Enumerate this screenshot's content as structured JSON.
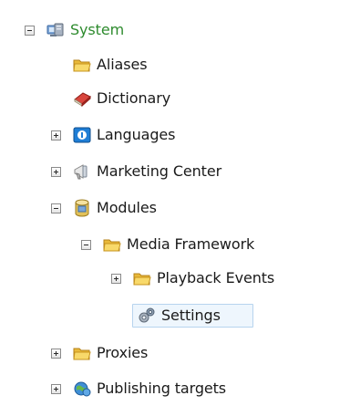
{
  "tree": {
    "system": {
      "label": "System",
      "icon": "system-icon",
      "state": "expanded"
    },
    "aliases": {
      "label": "Aliases",
      "icon": "folder-icon"
    },
    "dictionary": {
      "label": "Dictionary",
      "icon": "book-icon"
    },
    "languages": {
      "label": "Languages",
      "icon": "globe-flag-icon",
      "state": "collapsed"
    },
    "marketing_center": {
      "label": "Marketing Center",
      "icon": "megaphone-icon",
      "state": "collapsed"
    },
    "modules": {
      "label": "Modules",
      "icon": "cylinder-icon",
      "state": "expanded"
    },
    "media_framework": {
      "label": "Media Framework",
      "icon": "folder-icon",
      "state": "expanded"
    },
    "playback_events": {
      "label": "Playback Events",
      "icon": "folder-icon",
      "state": "collapsed"
    },
    "settings": {
      "label": "Settings",
      "icon": "gears-icon",
      "selected": true
    },
    "proxies": {
      "label": "Proxies",
      "icon": "folder-icon",
      "state": "collapsed"
    },
    "publishing_targets": {
      "label": "Publishing targets",
      "icon": "globe-icon",
      "state": "collapsed"
    }
  },
  "colors": {
    "system_label": "#2e8b2e",
    "selection_fill": "#eef6fd",
    "selection_border": "#b7d4ee"
  }
}
